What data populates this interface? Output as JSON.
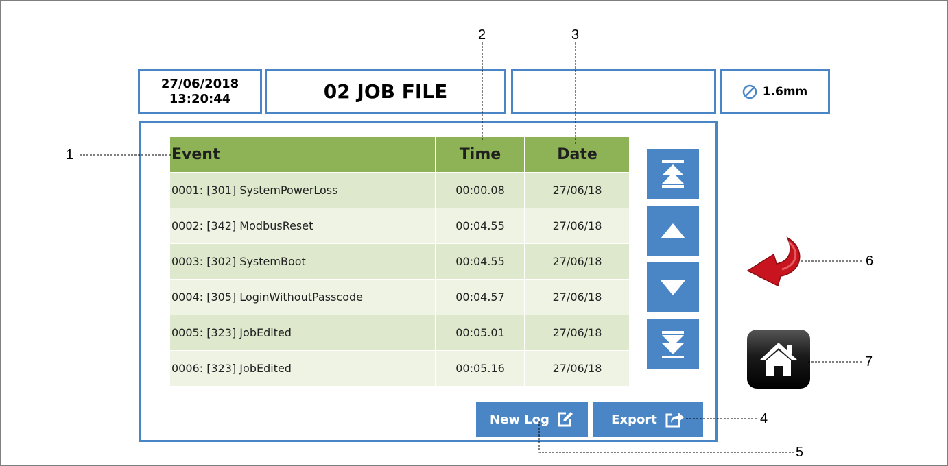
{
  "header": {
    "date": "27/06/2018",
    "time": "13:20:44",
    "job_title": "02 JOB FILE",
    "status_text": "",
    "wire_diameter": "1.6mm",
    "wire_icon": "diameter-icon"
  },
  "log_table": {
    "columns": {
      "event": "Event",
      "time": "Time",
      "date": "Date"
    },
    "rows": [
      {
        "event": "0001: [301] SystemPowerLoss",
        "time": "00:00.08",
        "date": "27/06/18"
      },
      {
        "event": "0002: [342] ModbusReset",
        "time": "00:04.55",
        "date": "27/06/18"
      },
      {
        "event": "0003: [302] SystemBoot",
        "time": "00:04.55",
        "date": "27/06/18"
      },
      {
        "event": "0004: [305] LoginWithoutPasscode",
        "time": "00:04.57",
        "date": "27/06/18"
      },
      {
        "event": "0005: [323] JobEdited",
        "time": "00:05.01",
        "date": "27/06/18"
      },
      {
        "event": "0006: [323] JobEdited",
        "time": "00:05.16",
        "date": "27/06/18"
      }
    ]
  },
  "scroll_buttons": [
    "scroll-top-icon",
    "scroll-up-icon",
    "scroll-down-icon",
    "scroll-bottom-icon"
  ],
  "actions": {
    "new_log_label": "New Log",
    "new_log_icon": "edit-icon",
    "export_label": "Export",
    "export_icon": "share-icon"
  },
  "side_buttons": {
    "back_icon": "back-arrow-icon",
    "home_icon": "home-icon"
  },
  "callouts": {
    "c1": "1",
    "c2": "2",
    "c3": "3",
    "c4": "4",
    "c5": "5",
    "c6": "6",
    "c7": "7"
  },
  "colors": {
    "frame_blue": "#4a86c5",
    "header_green": "#8db356",
    "row_dark": "#dde8cc",
    "row_light": "#eef3e4",
    "back_arrow_red": "#c8141e"
  }
}
